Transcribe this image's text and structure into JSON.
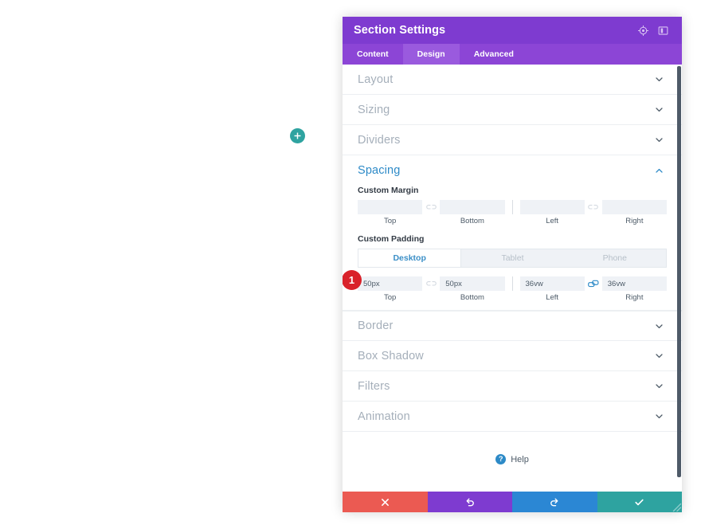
{
  "canvas": {
    "add_section_button": {
      "icon": "plus-icon",
      "color": "#2ea3a0"
    }
  },
  "panel": {
    "title": "Section Settings",
    "header_icons": [
      {
        "name": "target-icon",
        "label": ""
      },
      {
        "name": "layout-toggle-icon",
        "label": ""
      }
    ],
    "tabs": [
      {
        "label": "Content",
        "active": false
      },
      {
        "label": "Design",
        "active": true
      },
      {
        "label": "Advanced",
        "active": false
      }
    ],
    "sections": [
      {
        "label": "Layout",
        "open": false,
        "chevron": "chevron-down-icon"
      },
      {
        "label": "Sizing",
        "open": false,
        "chevron": "chevron-down-icon"
      },
      {
        "label": "Dividers",
        "open": false,
        "chevron": "chevron-down-icon"
      },
      {
        "label": "Spacing",
        "open": true,
        "chevron": "chevron-up-icon"
      },
      {
        "label": "Border",
        "open": false,
        "chevron": "chevron-down-icon"
      },
      {
        "label": "Box Shadow",
        "open": false,
        "chevron": "chevron-down-icon"
      },
      {
        "label": "Filters",
        "open": false,
        "chevron": "chevron-down-icon"
      },
      {
        "label": "Animation",
        "open": false,
        "chevron": "chevron-down-icon"
      }
    ],
    "spacing": {
      "margin": {
        "label": "Custom Margin",
        "top": {
          "value": "",
          "placeholder": "",
          "caption": "Top"
        },
        "bottom": {
          "value": "",
          "placeholder": "",
          "caption": "Bottom"
        },
        "left": {
          "value": "",
          "placeholder": "",
          "caption": "Left"
        },
        "right": {
          "value": "",
          "placeholder": "",
          "caption": "Right"
        },
        "link_top_bottom": {
          "icon": "link-broken-icon",
          "linked": false
        },
        "link_left_right": {
          "icon": "link-broken-icon",
          "linked": false
        }
      },
      "padding": {
        "label": "Custom Padding",
        "step_badge": "1",
        "devices": [
          {
            "label": "Desktop",
            "active": true
          },
          {
            "label": "Tablet",
            "active": false
          },
          {
            "label": "Phone",
            "active": false
          }
        ],
        "top": {
          "value": "50px",
          "caption": "Top"
        },
        "bottom": {
          "value": "50px",
          "caption": "Bottom"
        },
        "left": {
          "value": "36vw",
          "caption": "Left"
        },
        "right": {
          "value": "36vw",
          "caption": "Right"
        },
        "link_top_bottom": {
          "icon": "link-broken-icon",
          "linked": false
        },
        "link_left_right": {
          "icon": "link-icon",
          "linked": true
        }
      }
    },
    "help": {
      "label": "Help",
      "icon": "question-circle-icon"
    },
    "footer": [
      {
        "name": "cancel-button",
        "icon": "close-icon",
        "color": "#eb5a52"
      },
      {
        "name": "undo-button",
        "icon": "undo-icon",
        "color": "#7e3bd0"
      },
      {
        "name": "redo-button",
        "icon": "redo-icon",
        "color": "#2b87d4"
      },
      {
        "name": "save-button",
        "icon": "check-icon",
        "color": "#2ea3a0"
      }
    ]
  },
  "colors": {
    "header_purple": "#7e3bd0",
    "tabs_purple": "#8c45d6",
    "active_tab_purple": "#9a5ade",
    "accent_blue": "#2d8ac7",
    "teal": "#2ea3a0",
    "badge_red": "#d9222a"
  }
}
